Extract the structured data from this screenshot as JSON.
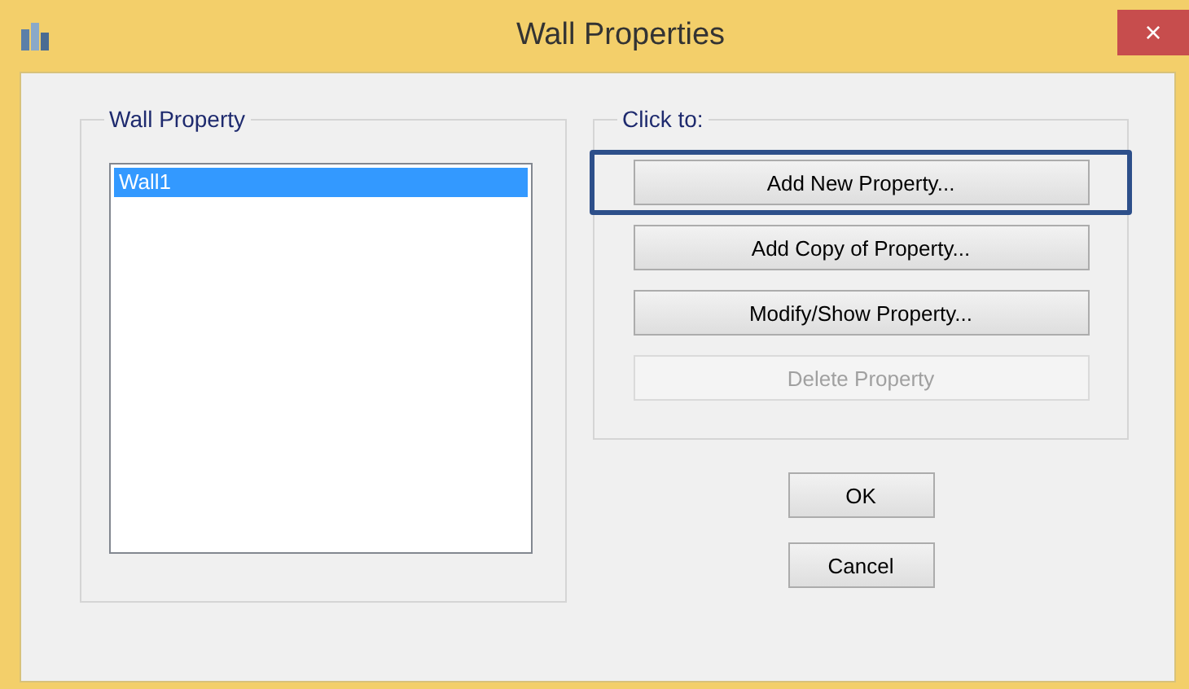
{
  "window": {
    "title": "Wall Properties",
    "close": "×"
  },
  "property_list": {
    "label": "Wall Property",
    "items": [
      {
        "label": "Wall1",
        "selected": true
      }
    ]
  },
  "actions": {
    "label": "Click to:",
    "buttons": [
      {
        "label": "Add New Property...",
        "disabled": false,
        "highlighted": true
      },
      {
        "label": "Add Copy of Property...",
        "disabled": false,
        "highlighted": false
      },
      {
        "label": "Modify/Show Property...",
        "disabled": false,
        "highlighted": false
      },
      {
        "label": "Delete Property",
        "disabled": true,
        "highlighted": false
      }
    ]
  },
  "buttons": [
    "OK",
    "Cancel"
  ]
}
